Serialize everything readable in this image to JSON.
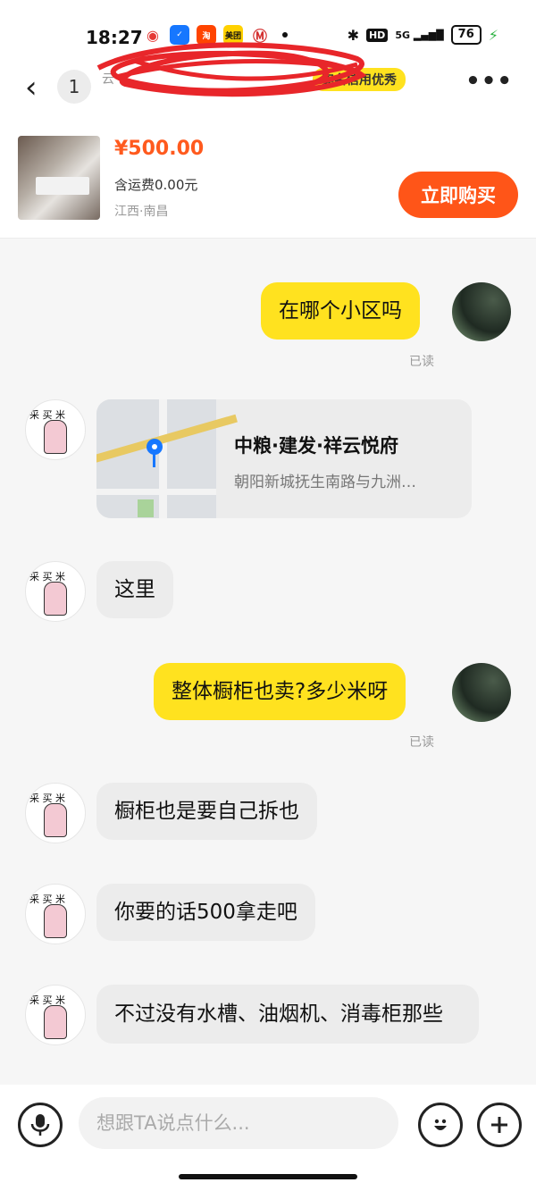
{
  "status_bar": {
    "time": "18:27",
    "app_icons": [
      "weibo-icon",
      "pay-icon",
      "taobao-icon",
      "meituan-icon",
      "metro-icon"
    ],
    "meituan_label": "美团",
    "hd_label": "HD",
    "network_label": "5G",
    "battery": "76",
    "colors": {
      "charging": "#2fb344"
    }
  },
  "header": {
    "unread_count": "1",
    "seller_name": "",
    "sub_text": "云",
    "credit_tag": "实名信用优秀"
  },
  "product": {
    "price": "¥500.00",
    "shipping": "含运费0.00元",
    "location": "江西·南昌",
    "buy_label": "立即购买"
  },
  "messages": {
    "m1": {
      "text": "在哪个小区吗",
      "status": "已读"
    },
    "m2": {
      "title": "中粮·建发·祥云悦府",
      "address": "朝阳新城抚生南路与九洲…"
    },
    "m3": {
      "text": "这里"
    },
    "m4": {
      "text": "整体橱柜也卖?多少米呀",
      "status": "已读"
    },
    "m5": {
      "text": "橱柜也是要自己拆也"
    },
    "m6": {
      "text": "你要的话500拿走吧"
    },
    "m7": {
      "text": "不过没有水槽、油烟机、消毒柜那些"
    }
  },
  "input": {
    "placeholder": "想跟TA说点什么..."
  },
  "colors": {
    "mine_bubble": "#ffe21f",
    "theirs_bubble": "#ececec",
    "buy_button": "#ff5518",
    "price": "#ff5a1e"
  }
}
